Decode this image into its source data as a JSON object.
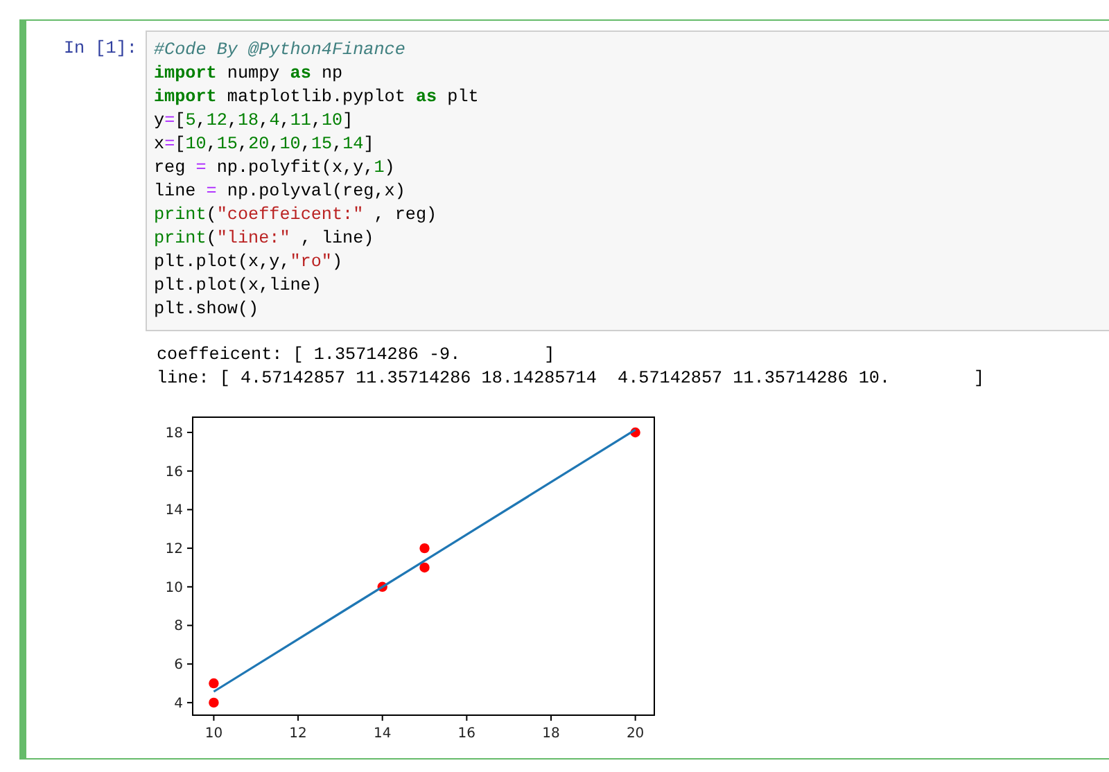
{
  "cell": {
    "prompt": "In [1]:",
    "code": [
      [
        {
          "kind": "comment",
          "text": "#Code By @Python4Finance"
        }
      ],
      [
        {
          "kind": "keyword",
          "text": "import"
        },
        {
          "kind": "plain",
          "text": " numpy "
        },
        {
          "kind": "keyword",
          "text": "as"
        },
        {
          "kind": "plain",
          "text": " np"
        }
      ],
      [
        {
          "kind": "keyword",
          "text": "import"
        },
        {
          "kind": "plain",
          "text": " matplotlib.pyplot "
        },
        {
          "kind": "keyword",
          "text": "as"
        },
        {
          "kind": "plain",
          "text": " plt"
        }
      ],
      [
        {
          "kind": "plain",
          "text": "y"
        },
        {
          "kind": "operator",
          "text": "="
        },
        {
          "kind": "plain",
          "text": "["
        },
        {
          "kind": "number",
          "text": "5"
        },
        {
          "kind": "plain",
          "text": ","
        },
        {
          "kind": "number",
          "text": "12"
        },
        {
          "kind": "plain",
          "text": ","
        },
        {
          "kind": "number",
          "text": "18"
        },
        {
          "kind": "plain",
          "text": ","
        },
        {
          "kind": "number",
          "text": "4"
        },
        {
          "kind": "plain",
          "text": ","
        },
        {
          "kind": "number",
          "text": "11"
        },
        {
          "kind": "plain",
          "text": ","
        },
        {
          "kind": "number",
          "text": "10"
        },
        {
          "kind": "plain",
          "text": "]"
        }
      ],
      [
        {
          "kind": "plain",
          "text": "x"
        },
        {
          "kind": "operator",
          "text": "="
        },
        {
          "kind": "plain",
          "text": "["
        },
        {
          "kind": "number",
          "text": "10"
        },
        {
          "kind": "plain",
          "text": ","
        },
        {
          "kind": "number",
          "text": "15"
        },
        {
          "kind": "plain",
          "text": ","
        },
        {
          "kind": "number",
          "text": "20"
        },
        {
          "kind": "plain",
          "text": ","
        },
        {
          "kind": "number",
          "text": "10"
        },
        {
          "kind": "plain",
          "text": ","
        },
        {
          "kind": "number",
          "text": "15"
        },
        {
          "kind": "plain",
          "text": ","
        },
        {
          "kind": "number",
          "text": "14"
        },
        {
          "kind": "plain",
          "text": "]"
        }
      ],
      [
        {
          "kind": "plain",
          "text": "reg "
        },
        {
          "kind": "operator",
          "text": "="
        },
        {
          "kind": "plain",
          "text": " np.polyfit(x,y,"
        },
        {
          "kind": "number",
          "text": "1"
        },
        {
          "kind": "plain",
          "text": ")"
        }
      ],
      [
        {
          "kind": "plain",
          "text": "line "
        },
        {
          "kind": "operator",
          "text": "="
        },
        {
          "kind": "plain",
          "text": " np.polyval(reg,x)"
        }
      ],
      [
        {
          "kind": "builtin",
          "text": "print"
        },
        {
          "kind": "plain",
          "text": "("
        },
        {
          "kind": "string",
          "text": "\"coeffeicent:\""
        },
        {
          "kind": "plain",
          "text": " , reg)"
        }
      ],
      [
        {
          "kind": "builtin",
          "text": "print"
        },
        {
          "kind": "plain",
          "text": "("
        },
        {
          "kind": "string",
          "text": "\"line:\""
        },
        {
          "kind": "plain",
          "text": " , line)"
        }
      ],
      [
        {
          "kind": "plain",
          "text": "plt.plot(x,y,"
        },
        {
          "kind": "string",
          "text": "\"ro\""
        },
        {
          "kind": "plain",
          "text": ")"
        }
      ],
      [
        {
          "kind": "plain",
          "text": "plt.plot(x,line)"
        }
      ],
      [
        {
          "kind": "plain",
          "text": "plt.show()"
        }
      ]
    ],
    "output": [
      "coeffeicent: [ 1.35714286 -9.        ]",
      "line: [ 4.57142857 11.35714286 18.14285714  4.57142857 11.35714286 10.        ]"
    ],
    "chart_data": {
      "type": "scatter",
      "x": [
        10,
        15,
        20,
        10,
        15,
        14
      ],
      "series": [
        {
          "type": "scatter",
          "color": "#ff0000",
          "values": [
            5,
            12,
            18,
            4,
            11,
            10
          ]
        },
        {
          "type": "line",
          "color": "#1f77b4",
          "values": [
            4.57,
            11.36,
            18.14,
            4.57,
            11.36,
            10
          ]
        }
      ],
      "xlim": [
        9.5,
        20.45
      ],
      "ylim": [
        3.35,
        18.79
      ],
      "xticks": [
        10,
        12,
        14,
        16,
        18,
        20
      ],
      "yticks": [
        4,
        6,
        8,
        10,
        12,
        14,
        16,
        18
      ]
    }
  }
}
